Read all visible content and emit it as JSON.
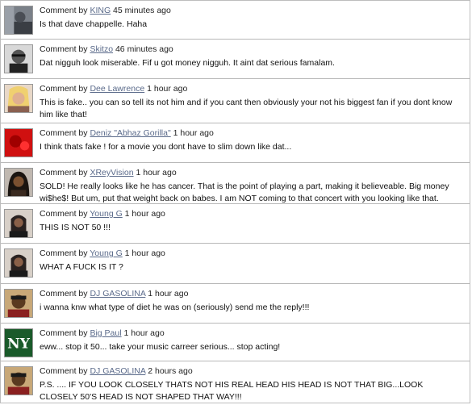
{
  "comment_prefix": "Comment by",
  "comments": [
    {
      "author": "KING",
      "time": "45 minutes ago",
      "text": "Is that dave chappelle. Haha"
    },
    {
      "author": "Skitzo",
      "time": "46 minutes ago",
      "text": "Dat nigguh look miserable. Fif u got money nigguh. It aint dat serious famalam."
    },
    {
      "author": "Dee Lawrence",
      "time": "1 hour ago",
      "text": "This is fake.. you can so tell its not him and if you cant then obviously your not his biggest fan if you dont know him like that!"
    },
    {
      "author": "Deniz \"Abhaz Gorilla\"",
      "time": "1 hour ago",
      "text": "I think thats fake ! for a movie you dont have to slim down like dat..."
    },
    {
      "author": "XReyVision",
      "time": "1 hour ago",
      "text": "SOLD! He really looks like he has cancer. That is the point of playing a part, making it believeable. Big money wi$he$! But um, put that weight back on babes. I am NOT coming to that concert with you looking like that."
    },
    {
      "author": "Young G",
      "time": "1 hour ago",
      "text": "THIS IS NOT 50 !!!"
    },
    {
      "author": "Young G",
      "time": "1 hour ago",
      "text": "WHAT A FUCK IS IT ?"
    },
    {
      "author": "DJ GASOLINA",
      "time": "1 hour ago",
      "text": "i wanna knw what type of diet he was on (seriously) send me the reply!!!"
    },
    {
      "author": "Big Paul",
      "time": "1 hour ago",
      "text": "eww... stop it 50... take your music carreer serious... stop acting!"
    },
    {
      "author": "DJ GASOLINA",
      "time": "2 hours ago",
      "text": "P.S. .... IF YOU LOOK CLOSELY THATS NOT HIS REAL HEAD HIS HEAD IS NOT THAT BIG...LOOK CLOSELY 50'S HEAD IS NOT SHAPED THAT WAY!!!"
    }
  ],
  "colors": {
    "link": "#5a6a8a",
    "divider": "#b8b8b8"
  }
}
